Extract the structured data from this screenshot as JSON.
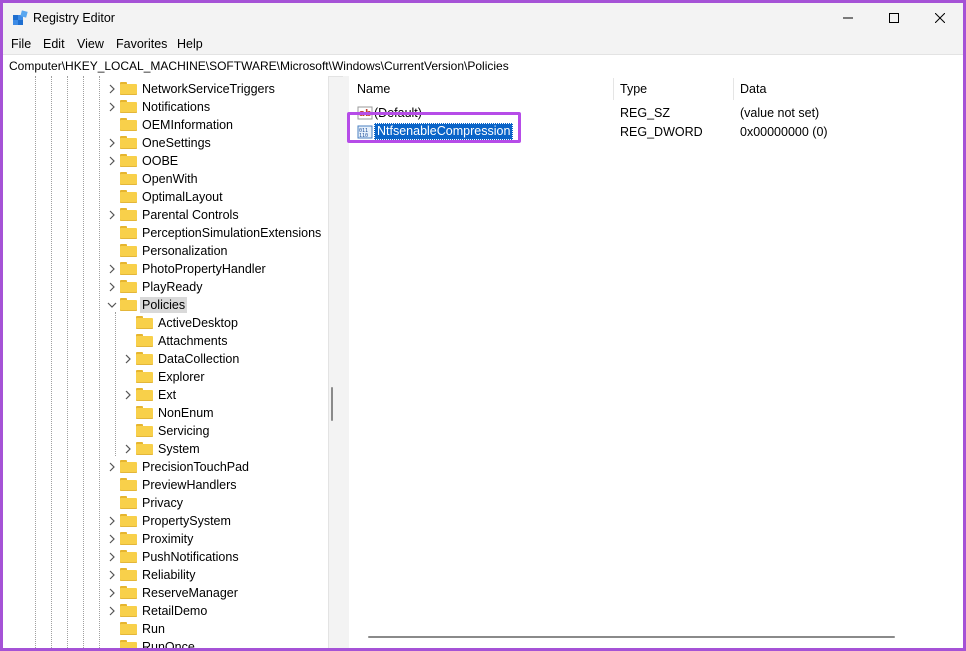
{
  "window": {
    "title": "Registry Editor",
    "controls": {
      "minimize": "–",
      "maximize": "☐",
      "close": "✕"
    }
  },
  "menu": [
    "File",
    "Edit",
    "View",
    "Favorites",
    "Help"
  ],
  "address": "Computer\\HKEY_LOCAL_MACHINE\\SOFTWARE\\Microsoft\\Windows\\CurrentVersion\\Policies",
  "tree": {
    "items": [
      {
        "label": "NetworkServiceTriggers",
        "expandable": true
      },
      {
        "label": "Notifications",
        "expandable": true
      },
      {
        "label": "OEMInformation",
        "expandable": false
      },
      {
        "label": "OneSettings",
        "expandable": true
      },
      {
        "label": "OOBE",
        "expandable": true
      },
      {
        "label": "OpenWith",
        "expandable": false
      },
      {
        "label": "OptimalLayout",
        "expandable": false
      },
      {
        "label": "Parental Controls",
        "expandable": true
      },
      {
        "label": "PerceptionSimulationExtensions",
        "expandable": false
      },
      {
        "label": "Personalization",
        "expandable": false
      },
      {
        "label": "PhotoPropertyHandler",
        "expandable": true
      },
      {
        "label": "PlayReady",
        "expandable": true
      },
      {
        "label": "Policies",
        "expandable": true,
        "expanded": true,
        "selected": true
      },
      {
        "label": "ActiveDesktop",
        "expandable": false,
        "child": true
      },
      {
        "label": "Attachments",
        "expandable": false,
        "child": true
      },
      {
        "label": "DataCollection",
        "expandable": true,
        "child": true
      },
      {
        "label": "Explorer",
        "expandable": false,
        "child": true
      },
      {
        "label": "Ext",
        "expandable": true,
        "child": true
      },
      {
        "label": "NonEnum",
        "expandable": false,
        "child": true
      },
      {
        "label": "Servicing",
        "expandable": false,
        "child": true
      },
      {
        "label": "System",
        "expandable": true,
        "child": true
      },
      {
        "label": "PrecisionTouchPad",
        "expandable": true
      },
      {
        "label": "PreviewHandlers",
        "expandable": false
      },
      {
        "label": "Privacy",
        "expandable": false
      },
      {
        "label": "PropertySystem",
        "expandable": true
      },
      {
        "label": "Proximity",
        "expandable": true
      },
      {
        "label": "PushNotifications",
        "expandable": true
      },
      {
        "label": "Reliability",
        "expandable": true
      },
      {
        "label": "ReserveManager",
        "expandable": true
      },
      {
        "label": "RetailDemo",
        "expandable": true
      },
      {
        "label": "Run",
        "expandable": false
      },
      {
        "label": "RunOnce",
        "expandable": false
      }
    ]
  },
  "list": {
    "columns": {
      "name": "Name",
      "type": "Type",
      "data": "Data"
    },
    "rows": [
      {
        "name": "(Default)",
        "type": "REG_SZ",
        "data": "(value not set)",
        "icon": "string-value-icon"
      },
      {
        "name": "NtfsenableCompression",
        "type": "REG_DWORD",
        "data": "0x00000000 (0)",
        "icon": "dword-value-icon",
        "selected": true
      }
    ]
  },
  "colors": {
    "accent": "#0a64c8",
    "highlight_border": "#b64ce8",
    "folder": "#f8d04a"
  }
}
